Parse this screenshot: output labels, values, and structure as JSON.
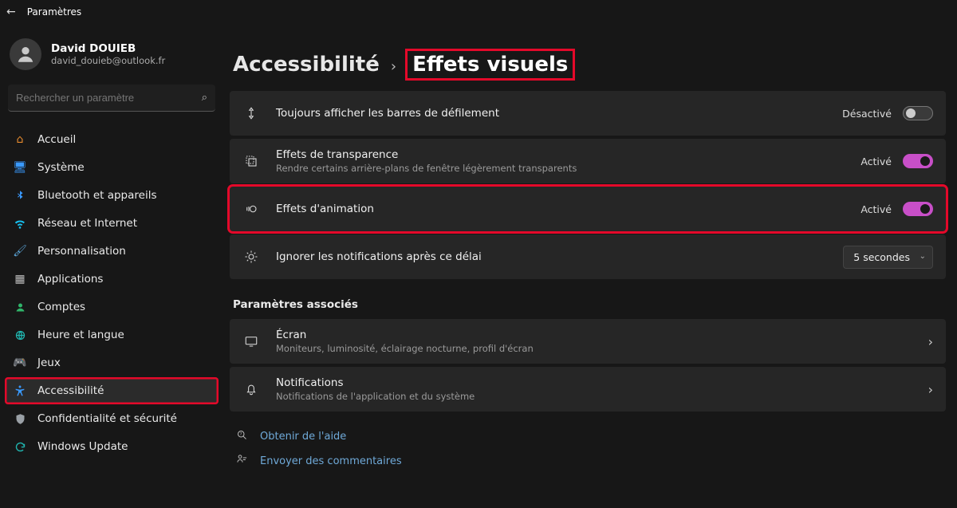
{
  "app_title": "Paramètres",
  "user": {
    "name": "David DOUIEB",
    "email": "david_douieb@outlook.fr"
  },
  "search": {
    "placeholder": "Rechercher un paramètre"
  },
  "sidebar": {
    "items": [
      {
        "label": "Accueil"
      },
      {
        "label": "Système"
      },
      {
        "label": "Bluetooth et appareils"
      },
      {
        "label": "Réseau et Internet"
      },
      {
        "label": "Personnalisation"
      },
      {
        "label": "Applications"
      },
      {
        "label": "Comptes"
      },
      {
        "label": "Heure et langue"
      },
      {
        "label": "Jeux"
      },
      {
        "label": "Accessibilité"
      },
      {
        "label": "Confidentialité et sécurité"
      },
      {
        "label": "Windows Update"
      }
    ]
  },
  "breadcrumb": {
    "parent": "Accessibilité",
    "current": "Effets visuels"
  },
  "settings": {
    "scrollbars": {
      "title": "Toujours afficher les barres de défilement",
      "state_label": "Désactivé"
    },
    "transparency": {
      "title": "Effets de transparence",
      "sub": "Rendre certains arrière-plans de fenêtre légèrement transparents",
      "state_label": "Activé"
    },
    "animation": {
      "title": "Effets d'animation",
      "state_label": "Activé"
    },
    "notifications_delay": {
      "title": "Ignorer les notifications après ce délai",
      "value": "5 secondes"
    }
  },
  "related": {
    "heading": "Paramètres associés",
    "screen": {
      "title": "Écran",
      "sub": "Moniteurs, luminosité, éclairage nocturne, profil d'écran"
    },
    "notifications": {
      "title": "Notifications",
      "sub": "Notifications de l'application et du système"
    }
  },
  "footer": {
    "help": "Obtenir de l'aide",
    "feedback": "Envoyer des commentaires"
  }
}
